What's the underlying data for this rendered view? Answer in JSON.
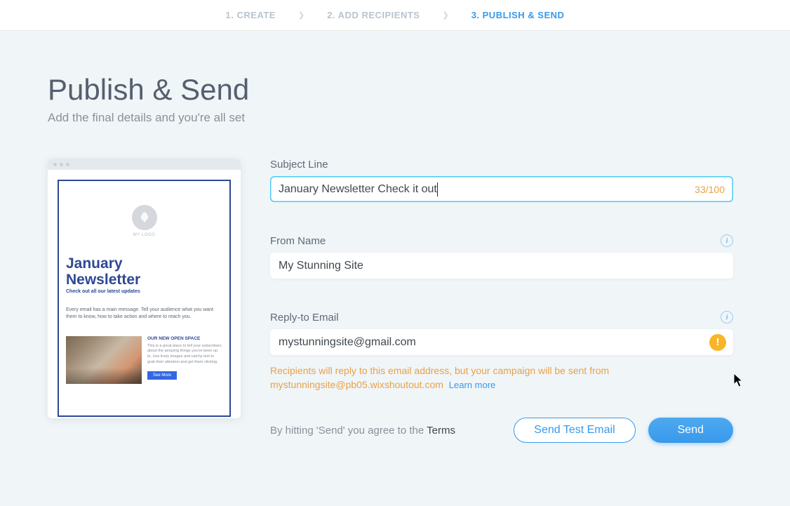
{
  "stepper": {
    "step1": "1. CREATE",
    "step2": "2. ADD RECIPIENTS",
    "step3": "3. PUBLISH & SEND"
  },
  "page": {
    "title": "Publish & Send",
    "subtitle": "Add the final details and you're all set"
  },
  "preview": {
    "mylogo": "MY LOGO",
    "title_l1": "January",
    "title_l2": "Newsletter",
    "subtitle": "Check out all our latest updates",
    "body": "Every email has a main message. Tell your audience what you want them to know, how to take action and where to reach you.",
    "open_label": "OUR NEW OPEN SPACE",
    "open_desc": "This is a great place to tell your subscribers about the amazing things you've been up to. Use lively images and catchy text to grab their attention and get them clicking.",
    "seemore": "See More"
  },
  "form": {
    "subject_label": "Subject Line",
    "subject_value": "January  Newsletter  Check it out",
    "subject_counter": "33/100",
    "from_label": "From Name",
    "from_value": "My Stunning Site",
    "reply_label": "Reply-to Email",
    "reply_value": "mystunningsite@gmail.com",
    "warn_text": "Recipients will reply to this email address, but your campaign will be sent from mystunningsite@pb05.wixshoutout.com",
    "learn_more": "Learn more",
    "agree_prefix": "By hitting 'Send' you agree to the ",
    "agree_terms": "Terms",
    "btn_test": "Send Test Email",
    "btn_send": "Send"
  }
}
